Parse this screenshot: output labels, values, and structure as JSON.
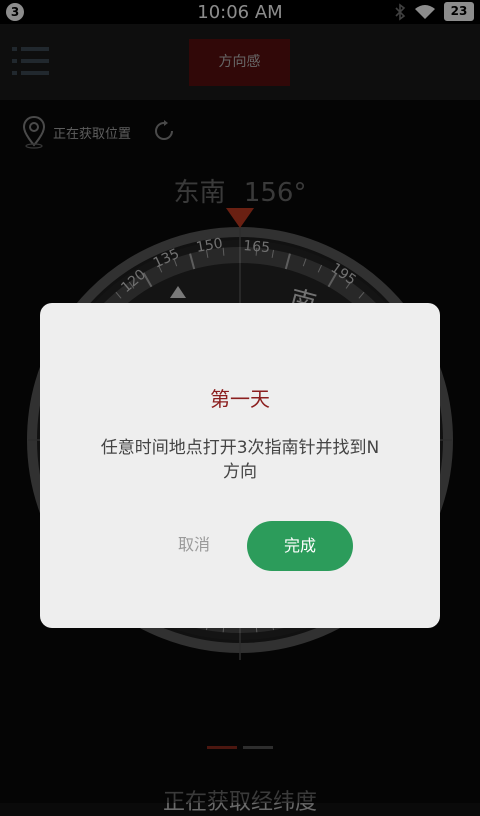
{
  "status_bar": {
    "notification_count": "3",
    "time": "10:06 AM",
    "battery": "23"
  },
  "app_bar": {
    "title": "方向感"
  },
  "location": {
    "text": "正在获取位置"
  },
  "compass": {
    "heading_label": "东南",
    "heading_degrees": "156°",
    "degree_ticks": [
      "120",
      "135",
      "150",
      "165",
      "195"
    ],
    "direction_letter": "南",
    "needle_color": "#c23b22"
  },
  "bottom_text": "正在获取经纬度",
  "dialog": {
    "title": "第一天",
    "message": "任意时间地点打开3次指南针并找到N方向",
    "cancel_label": "取消",
    "ok_label": "完成",
    "ok_color": "#2c9c5b"
  }
}
